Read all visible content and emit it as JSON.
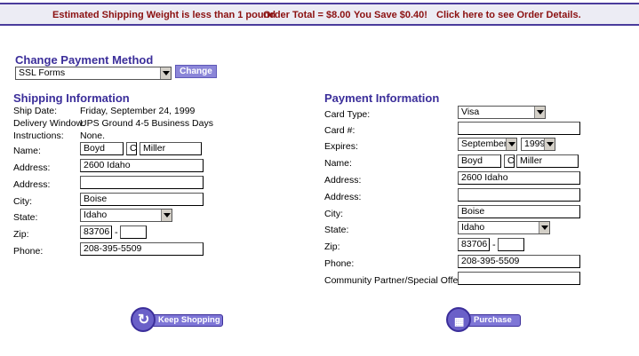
{
  "banner": {
    "weight": "Estimated Shipping Weight is less than 1 pound",
    "total": "Order Total = $8.00",
    "save": "You Save $0.40!",
    "details_link": "Click here to see Order Details."
  },
  "change_payment": {
    "title": "Change Payment Method",
    "method_selected": "SSL Forms",
    "button": "Change"
  },
  "shipping": {
    "title": "Shipping Information",
    "ship_date_label": "Ship Date:",
    "ship_date": "Friday, September 24, 1999",
    "delivery_label": "Delivery Window:",
    "delivery": "UPS Ground 4-5 Business Days",
    "instructions_label": "Instructions:",
    "instructions": "None.",
    "name_label": "Name:",
    "first_name": "Boyd",
    "middle_initial": "C",
    "last_name": "Miller",
    "address_label": "Address:",
    "address1": "2600 Idaho",
    "address2_label": "Address:",
    "address2": "",
    "city_label": "City:",
    "city": "Boise",
    "state_label": "State:",
    "state": "Idaho",
    "zip_label": "Zip:",
    "zip": "83706",
    "zip_ext": "",
    "phone_label": "Phone:",
    "phone": "208-395-5509"
  },
  "payment": {
    "title": "Payment Information",
    "card_type_label": "Card Type:",
    "card_type": "Visa",
    "card_number_label": "Card #:",
    "card_number": "",
    "expires_label": "Expires:",
    "expires_month": "September",
    "expires_year": "1999",
    "name_label": "Name:",
    "first_name": "Boyd",
    "middle_initial": "C",
    "last_name": "Miller",
    "address_label": "Address:",
    "address1": "2600 Idaho",
    "address2_label": "Address:",
    "address2": "",
    "city_label": "City:",
    "city": "Boise",
    "state_label": "State:",
    "state": "Idaho",
    "zip_label": "Zip:",
    "zip": "83706",
    "zip_ext": "",
    "phone_label": "Phone:",
    "phone": "208-395-5509",
    "partner_label": "Community Partner/Special Offers:",
    "partner": ""
  },
  "buttons": {
    "keep_shopping": "Keep Shopping",
    "purchase": "Purchase",
    "keep_shopping_icon": "refresh-arrow-icon",
    "purchase_icon": "cash-register-icon"
  },
  "colors": {
    "accent": "#3b2e9a",
    "banner_text": "#8b1010",
    "button_fill": "#8b86d8"
  }
}
